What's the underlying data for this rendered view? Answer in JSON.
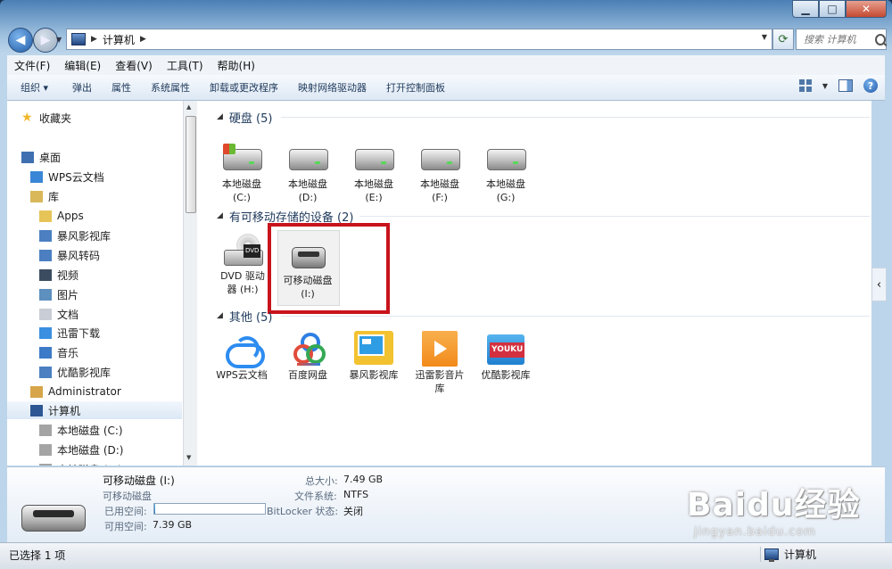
{
  "window": {
    "minimize": "▁",
    "maximize": "□",
    "close": "✕"
  },
  "address": {
    "root_sep": "▶",
    "path": "计算机",
    "end_sep": "▶",
    "search_placeholder": "搜索 计算机"
  },
  "menubar": [
    "文件(F)",
    "编辑(E)",
    "查看(V)",
    "工具(T)",
    "帮助(H)"
  ],
  "toolbar": {
    "organize": "组织 ▾",
    "items": [
      "弹出",
      "属性",
      "系统属性",
      "卸载或更改程序",
      "映射网络驱动器",
      "打开控制面板"
    ]
  },
  "sidebar": {
    "items": [
      {
        "label": "收藏夹",
        "icon": "star-icon"
      },
      {
        "label": "桌面",
        "icon": "desktop-icon"
      },
      {
        "label": "WPS云文档",
        "icon": "cloud-icon"
      },
      {
        "label": "库",
        "icon": "library-icon"
      },
      {
        "label": "Apps",
        "icon": "folder-icon"
      },
      {
        "label": "暴风影视库",
        "icon": "video-library-icon"
      },
      {
        "label": "暴风转码",
        "icon": "video-library-icon"
      },
      {
        "label": "视频",
        "icon": "video-icon"
      },
      {
        "label": "图片",
        "icon": "picture-icon"
      },
      {
        "label": "文档",
        "icon": "document-icon"
      },
      {
        "label": "迅雷下载",
        "icon": "download-icon"
      },
      {
        "label": "音乐",
        "icon": "music-icon"
      },
      {
        "label": "优酷影视库",
        "icon": "video-library-icon"
      },
      {
        "label": "Administrator",
        "icon": "user-folder-icon"
      },
      {
        "label": "计算机",
        "icon": "computer-icon"
      },
      {
        "label": "本地磁盘 (C:)",
        "icon": "drive-icon"
      },
      {
        "label": "本地磁盘 (D:)",
        "icon": "drive-icon"
      },
      {
        "label": "本地磁盘 (E:)",
        "icon": "drive-icon"
      }
    ]
  },
  "groups": {
    "hard_disks": {
      "title": "硬盘 (5)",
      "drives": [
        {
          "name": "本地磁盘",
          "letter": "(C:)"
        },
        {
          "name": "本地磁盘",
          "letter": "(D:)"
        },
        {
          "name": "本地磁盘",
          "letter": "(E:)"
        },
        {
          "name": "本地磁盘",
          "letter": "(F:)"
        },
        {
          "name": "本地磁盘",
          "letter": "(G:)"
        }
      ]
    },
    "removable": {
      "title": "有可移动存储的设备 (2)",
      "devices": [
        {
          "name": "DVD 驱动",
          "letter": "器 (H:)",
          "badge": "DVD"
        },
        {
          "name": "可移动磁盘",
          "letter": "(I:)"
        }
      ]
    },
    "other": {
      "title": "其他 (5)",
      "items": [
        {
          "line1": "WPS云文档",
          "line2": ""
        },
        {
          "line1": "百度网盘",
          "line2": ""
        },
        {
          "line1": "暴风影视库",
          "line2": ""
        },
        {
          "line1": "迅雷影音片",
          "line2": "库"
        },
        {
          "line1": "优酷影视库",
          "line2": "",
          "badge": "YOUKU"
        }
      ]
    }
  },
  "details": {
    "title": "可移动磁盘 (I:)",
    "type": "可移动磁盘",
    "used_label": "已用空间:",
    "used_fraction": 0.01,
    "free_label": "可用空间:",
    "free_value": "7.39 GB",
    "total_label": "总大小:",
    "total_value": "7.49 GB",
    "fs_label": "文件系统:",
    "fs_value": "NTFS",
    "bitlocker_label": "BitLocker 状态:",
    "bitlocker_value": "关闭"
  },
  "status": {
    "selected": "已选择 1 项",
    "location": "计算机"
  },
  "watermark": {
    "main": "Baidu经验",
    "sub": "jingyan.baidu.com"
  }
}
